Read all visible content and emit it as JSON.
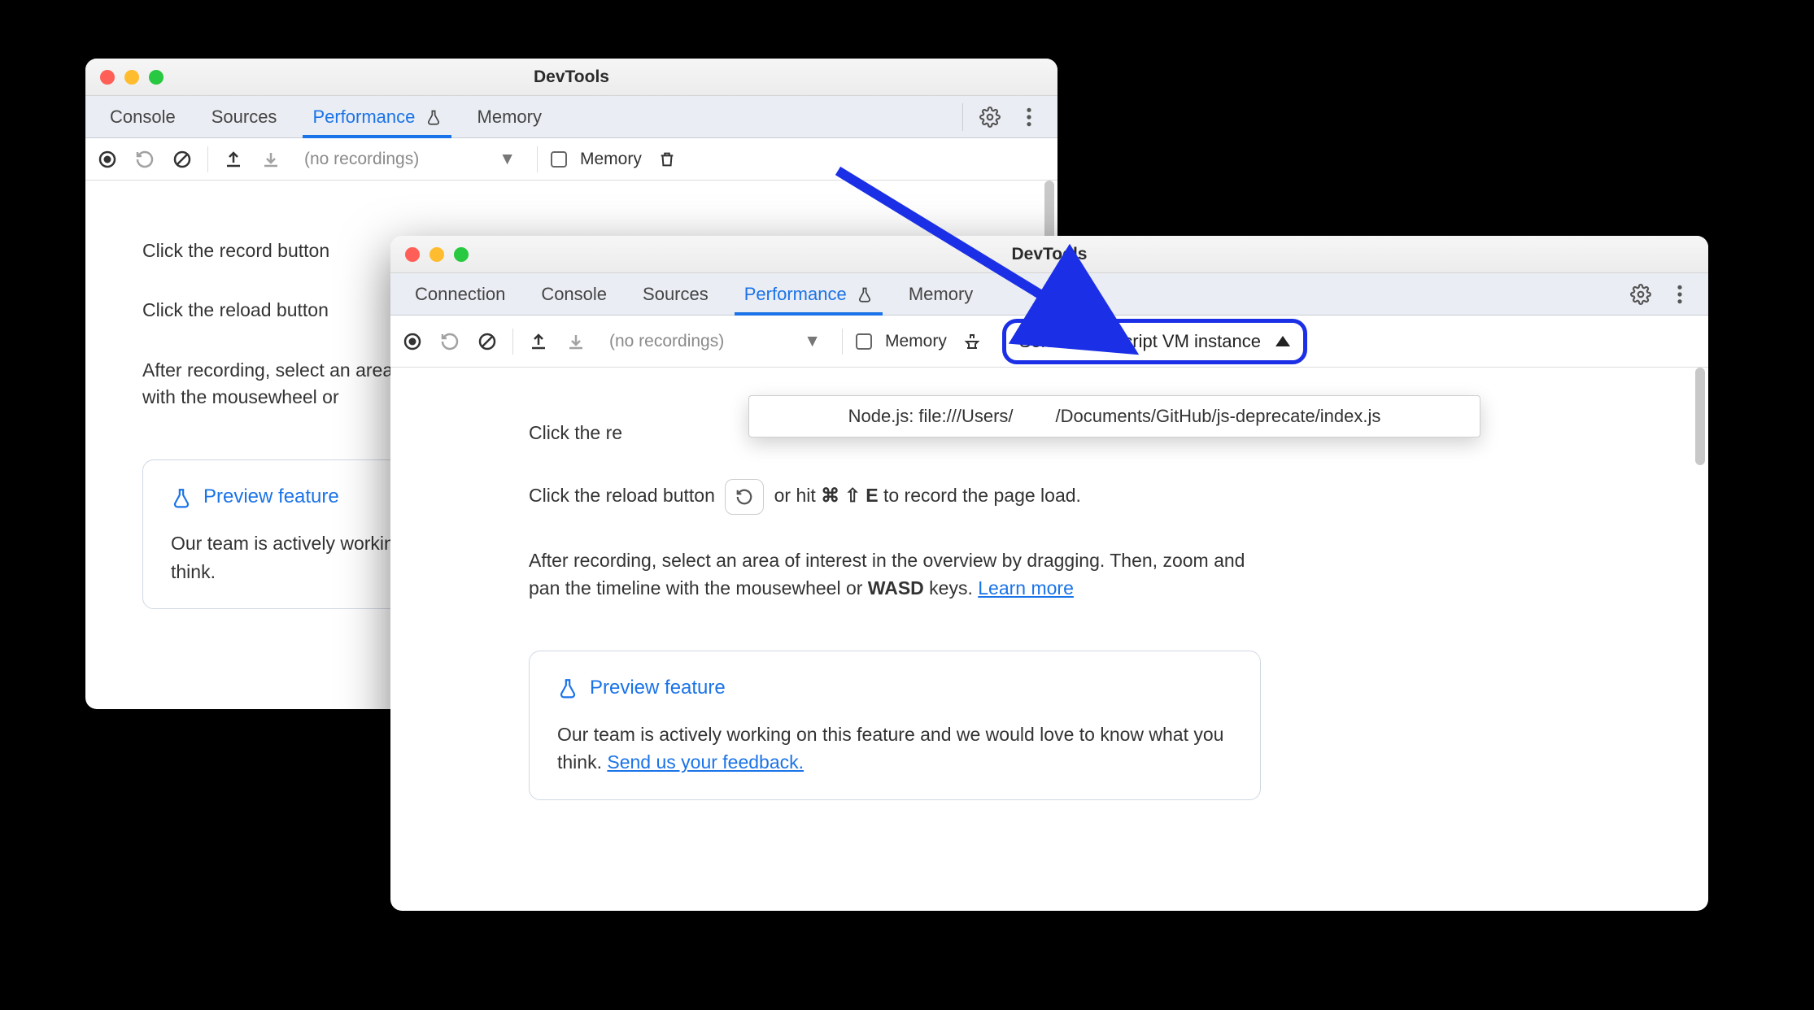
{
  "window_title": "DevTools",
  "tabs_win1": [
    "Console",
    "Sources",
    "Performance",
    "Memory"
  ],
  "tabs_win2": [
    "Connection",
    "Console",
    "Sources",
    "Performance",
    "Memory"
  ],
  "active_tab": "Performance",
  "recordings_placeholder": "(no recordings)",
  "memory_checkbox_label": "Memory",
  "vm_select_label": "Select JavaScript VM instance",
  "dropdown_item_prefix": "Node.js: file:///Users/",
  "dropdown_item_suffix": "/Documents/GitHub/js-deprecate/index.js",
  "hint_record_prefix": "Click the record button ",
  "hint_record_suffix_partial": "",
  "hint_reload_prefix": "Click the reload button ",
  "hint_reload_mid": " or hit ",
  "hint_reload_keys": "⌘ ⇧ E",
  "hint_reload_suffix": " to record the page load.",
  "hint_after_text": "After recording, select an area of interest in the overview by dragging. Then, zoom and pan the timeline with the mousewheel or ",
  "hint_after_wasd": "WASD",
  "hint_after_tail": " keys. ",
  "learn_more": "Learn more",
  "preview_title": "Preview feature",
  "preview_body_text": "Our team is actively working on this feature and we would love to know what you think. ",
  "preview_link": "Send us your feedback."
}
